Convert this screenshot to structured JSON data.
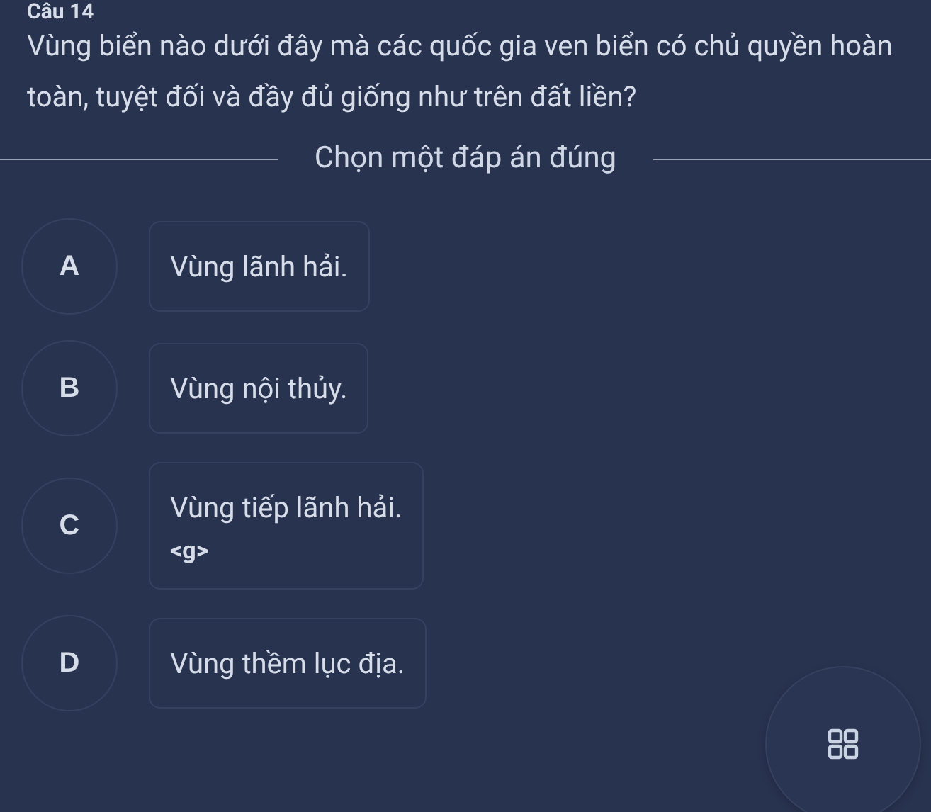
{
  "question": {
    "number": "Câu 14",
    "text": "Vùng biển nào dưới đây mà các quốc gia ven biển có chủ quyền hoàn toàn, tuyệt đối và đầy đủ giống như trên đất liền?"
  },
  "instruction": "Chọn một đáp án đúng",
  "options": [
    {
      "letter": "A",
      "text": "Vùng lãnh hải.",
      "selected": false
    },
    {
      "letter": "B",
      "text": "Vùng nội thủy.",
      "selected": false
    },
    {
      "letter": "C",
      "text": "Vùng tiếp lãnh hải.",
      "extra": "<g>",
      "selected": false
    },
    {
      "letter": "D",
      "text": "Vùng thềm lục địa.",
      "selected": false
    }
  ]
}
